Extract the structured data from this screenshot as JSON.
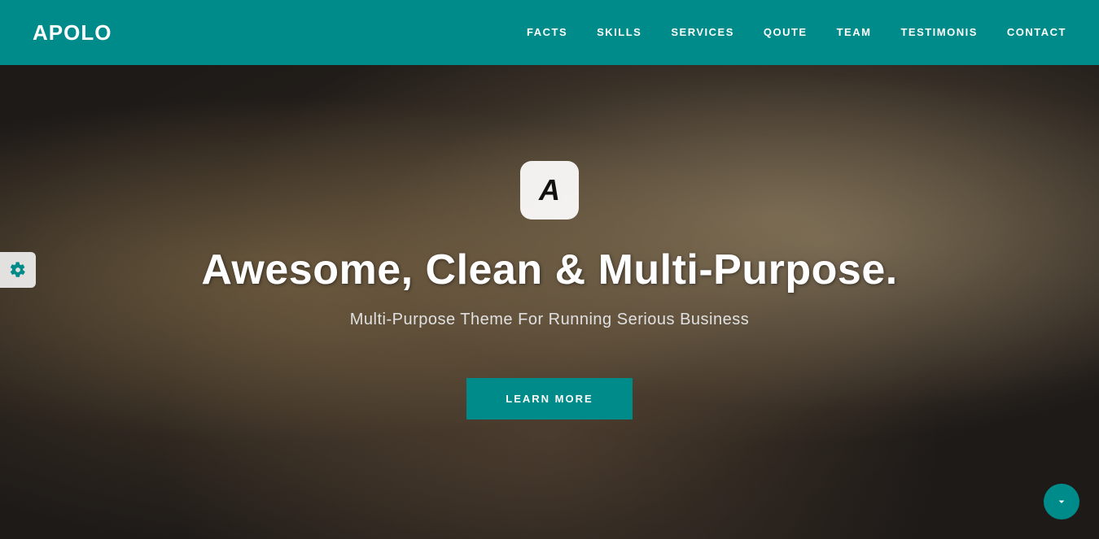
{
  "navbar": {
    "brand": "APOLO",
    "nav_items": [
      {
        "label": "FACTS",
        "href": "#facts"
      },
      {
        "label": "SKILLS",
        "href": "#skills"
      },
      {
        "label": "SERVICES",
        "href": "#services"
      },
      {
        "label": "QOUTE",
        "href": "#qoute"
      },
      {
        "label": "TEAM",
        "href": "#team"
      },
      {
        "label": "TESTIMONIS",
        "href": "#testimonis"
      },
      {
        "label": "CONTACT",
        "href": "#contact"
      }
    ]
  },
  "hero": {
    "logo_letter": "A",
    "title": "Awesome, Clean & Multi-Purpose.",
    "subtitle": "Multi-Purpose Theme For Running Serious Business",
    "cta_label": "LEARN MORE"
  },
  "colors": {
    "brand": "#008B8B",
    "navbar_bg": "#008B8B",
    "hero_overlay": "rgba(0,0,0,0.5)"
  }
}
